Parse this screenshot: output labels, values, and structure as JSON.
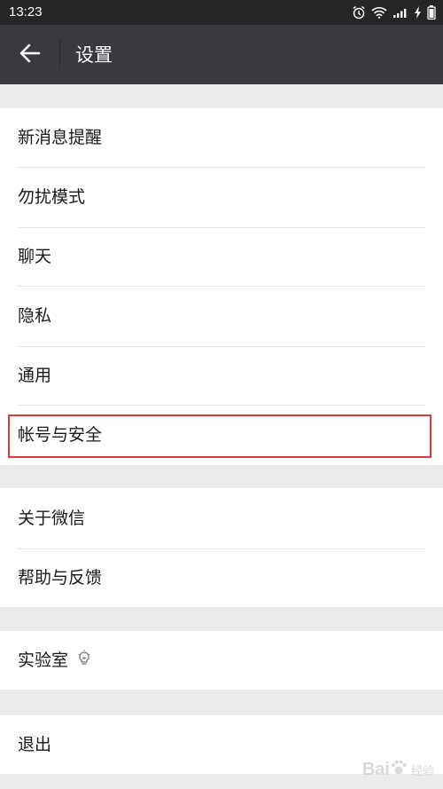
{
  "status_bar": {
    "time": "13:23",
    "icons": [
      "alarm-icon",
      "wifi-icon",
      "signal-icon",
      "charging-icon",
      "battery-icon"
    ]
  },
  "app_bar": {
    "title": "设置",
    "back_icon": "arrow-left-icon"
  },
  "groups": [
    {
      "items": [
        "新消息提醒",
        "勿扰模式",
        "聊天",
        "隐私",
        "通用",
        "帐号与安全"
      ]
    },
    {
      "items": [
        "关于微信",
        "帮助与反馈"
      ]
    },
    {
      "items": [
        "实验室"
      ]
    },
    {
      "items": [
        "退出"
      ]
    }
  ],
  "highlight_color": "#e03a3a",
  "watermark": {
    "brand": "Bai",
    "sub": "经验"
  }
}
